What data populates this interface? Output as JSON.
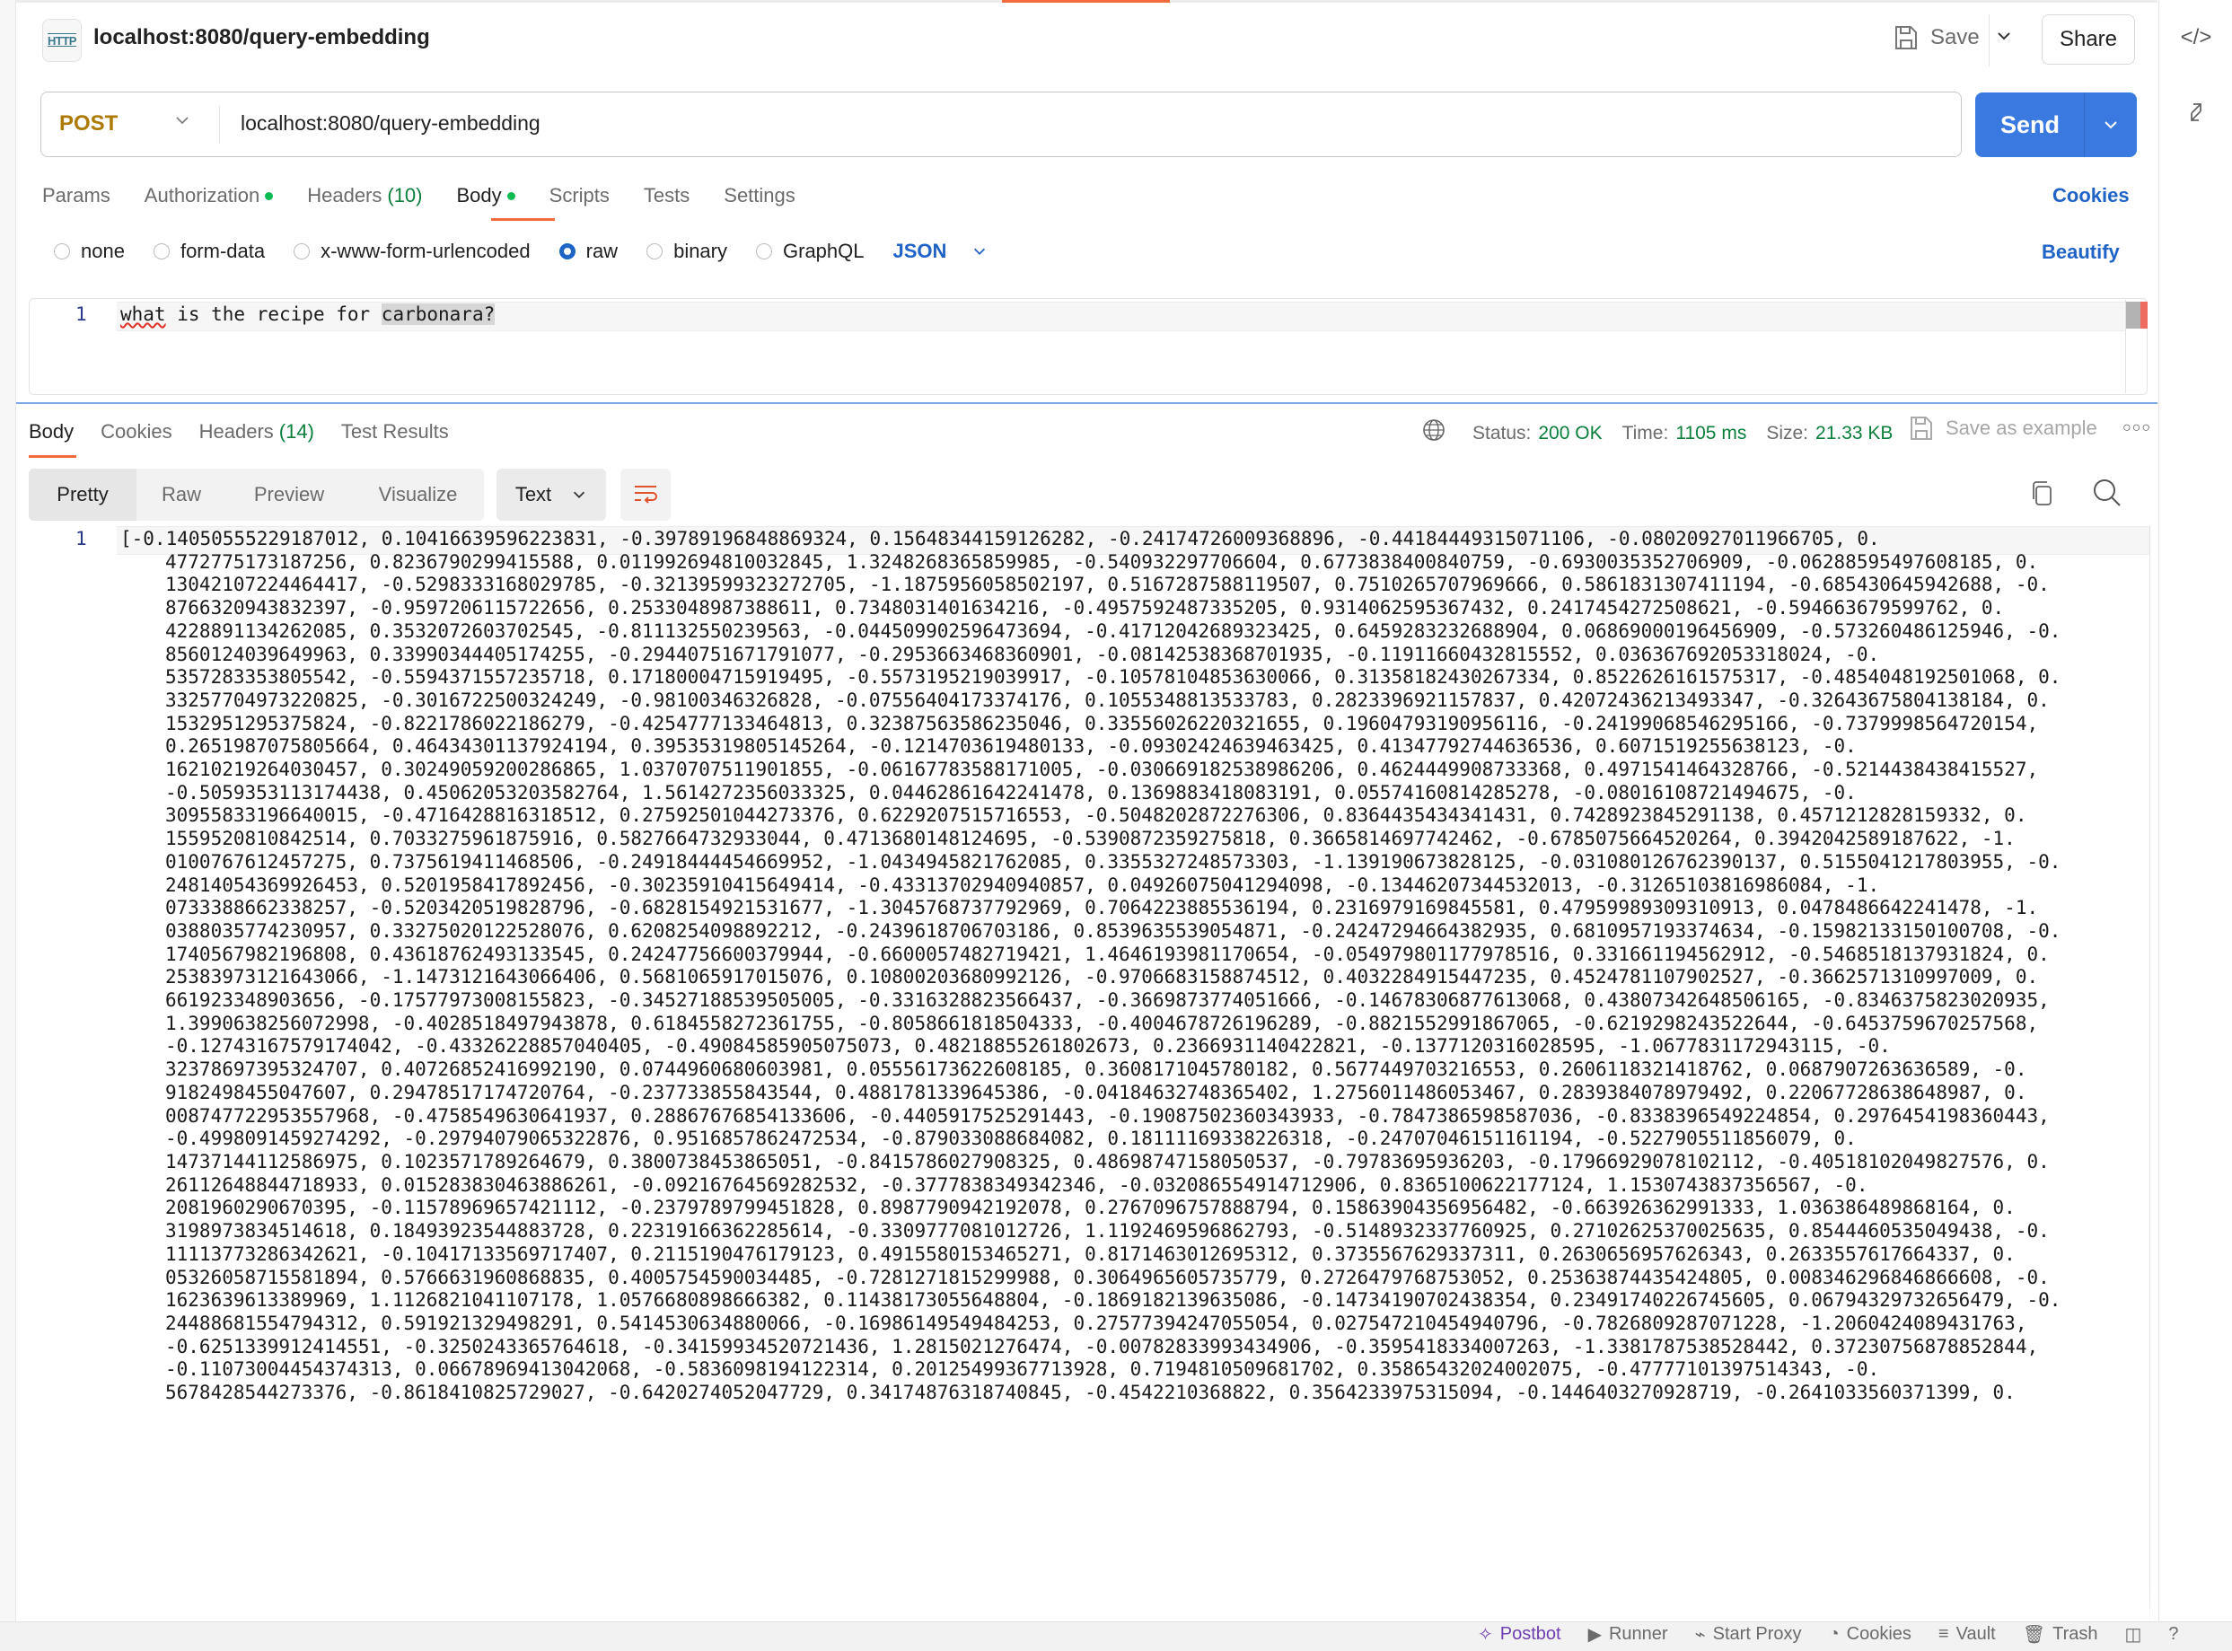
{
  "request": {
    "title": "localhost:8080/query-embedding",
    "icon": "http-icon",
    "icon_label": "HTTP",
    "save_label": "Save",
    "share_label": "Share",
    "method": "POST",
    "url": "localhost:8080/query-embedding",
    "send_label": "Send",
    "tabs": [
      {
        "label": "Params",
        "dot": false,
        "count": null
      },
      {
        "label": "Authorization",
        "dot": true,
        "count": null
      },
      {
        "label": "Headers",
        "dot": false,
        "count": "(10)"
      },
      {
        "label": "Body",
        "dot": true,
        "count": null,
        "active": true
      },
      {
        "label": "Scripts",
        "dot": false,
        "count": null
      },
      {
        "label": "Tests",
        "dot": false,
        "count": null
      },
      {
        "label": "Settings",
        "dot": false,
        "count": null
      }
    ],
    "cookies_link": "Cookies",
    "body_types": [
      {
        "label": "none",
        "checked": false
      },
      {
        "label": "form-data",
        "checked": false
      },
      {
        "label": "x-www-form-urlencoded",
        "checked": false
      },
      {
        "label": "raw",
        "checked": true
      },
      {
        "label": "binary",
        "checked": false
      },
      {
        "label": "GraphQL",
        "checked": false
      }
    ],
    "raw_format": "JSON",
    "beautify_label": "Beautify",
    "editor": {
      "line_number": "1",
      "text_prefix": "what is the recipe for ",
      "text_squiggled": "what",
      "text_between": " is the recipe for ",
      "text_selected": "carbonara?"
    }
  },
  "response": {
    "tabs": [
      {
        "label": "Body",
        "active": true
      },
      {
        "label": "Cookies"
      },
      {
        "label": "Headers",
        "count": "(14)"
      },
      {
        "label": "Test Results"
      }
    ],
    "status_label": "Status:",
    "status_value": "200 OK",
    "time_label": "Time:",
    "time_value": "1105 ms",
    "size_label": "Size:",
    "size_value": "21.33 KB",
    "save_example_label": "Save as example",
    "view_modes": [
      "Pretty",
      "Raw",
      "Preview",
      "Visualize"
    ],
    "active_view": "Pretty",
    "format": "Text",
    "line_number": "1",
    "body_lines": [
      "[-0.14050555229187012, 0.10416639596223831, -0.39789196848869324, 0.15648344159126282, -0.24174726009368896, -0.44184449315071106, -0.08020927011966705, 0.",
      "4772775173187256, 0.8236790299415588, 0.011992694810032845, 1.3248268365859985, -0.540932297706604, 0.6773838400840759, -0.6930035352706909, -0.06288595497608185, 0.",
      "13042107224464417, -0.5298333168029785, -0.32139599323272705, -1.1875956058502197, 0.5167287588119507, 0.7510265707969666, 0.5861831307411194, -0.685430645942688, -0.",
      "8766320943832397, -0.9597206115722656, 0.2533048987388611, 0.7348031401634216, -0.4957592487335205, 0.9314062595367432, 0.2417454272508621, -0.594663679599762, 0.",
      "4228891134262085, 0.3532072603702545, -0.811132550239563, -0.044509902596473694, -0.41712042689323425, 0.6459283232688904, 0.06869000196456909, -0.573260486125946, -0.",
      "8560124039649963, 0.33990344405174255, -0.29440751671791077, -0.2953663468360901, -0.08142538368701935, -0.11911660432815552, 0.036367692053318024, -0.",
      "5357283353805542, -0.5594371557235718, 0.17180004715919495, -0.5573195219039917, -0.10578104853630066, 0.31358182430267334, 0.8522626161575317, -0.4854048192501068, 0.",
      "33257704973220825, -0.3016722500324249, -0.98100346326828, -0.07556404173374176, 0.1055348813533783, 0.2823396921157837, 0.42072436213493347, -0.32643675804138184, 0.",
      "1532951295375824, -0.8221786022186279, -0.4254777133464813, 0.32387563586235046, 0.33556026220321655, 0.19604793190956116, -0.24199068546295166, -0.7379998564720154,",
      "0.2651987075805664, 0.46434301137924194, 0.39535319805145264, -0.1214703619480133, -0.09302424639463425, 0.41347792744636536, 0.6071519255638123, -0.",
      "16210219264030457, 0.30249059200286865, 1.0370707511901855, -0.06167783588171005, -0.030669182538986206, 0.4624449908733368, 0.4971541464328766, -0.5214438438415527,",
      "-0.5059353113174438, 0.45062053203582764, 1.5614272356033325, 0.04462861642241478, 0.1369883418083191, 0.05574160814285278, -0.08016108721494675, -0.",
      "30955833196640015, -0.4716428816318512, 0.27592501044273376, 0.6229207515716553, -0.5048202872276306, 0.8364435434341431, 0.7428923845291138, 0.4571212828159332, 0.",
      "1559520810842514, 0.7033275961875916, 0.5827664732933044, 0.4713680148124695, -0.5390872359275818, 0.3665814697742462, -0.6785075664520264, 0.3942042589187622, -1.",
      "0100767612457275, 0.7375619411468506, -0.24918444454669952, -1.0434945821762085, 0.3355327248573303, -1.139190673828125, -0.031080126762390137, 0.5155041217803955, -0.",
      "24814054369926453, 0.5201958417892456, -0.30235910415649414, -0.43313702940940857, 0.04926075041294098, -0.13446207344532013, -0.31265103816986084, -1.",
      "0733388662338257, -0.5203420519828796, -0.6828154921531677, -1.3045768737792969, 0.7064223885536194, 0.2316979169845581, 0.47959989309310913, 0.0478486642241478, -1.",
      "0388035774230957, 0.33275020122528076, 0.6208254098892212, -0.2439618706703186, 0.8539635539054871, -0.24247294664382935, 0.6810957193374634, -0.15982133150100708, -0.",
      "1740567982196808, 0.43618762493133545, 0.24247756600379944, -0.6600057482719421, 1.4646193981170654, -0.054979801177978516, 0.331661194562912, -0.5468518137931824, 0.",
      "25383973121643066, -1.1473121643066406, 0.5681065917015076, 0.10800203680992126, -0.9706683158874512, 0.4032284915447235, 0.4524781107902527, -0.3662571310997009, 0.",
      "661923348903656, -0.17577973008155823, -0.34527188539505005, -0.3316328823566437, -0.3669873774051666, -0.14678306877613068, 0.43807342648506165, -0.8346375823020935,",
      "1.3990638256072998, -0.4028518497943878, 0.6184558272361755, -0.8058661818504333, -0.4004678726196289, -0.8821552991867065, -0.6219298243522644, -0.6453759670257568,",
      "-0.12743167579174042, -0.43326228857040405, -0.49084585905075073, 0.48218855261802673, 0.2366931140422821, -0.1377120316028595, -1.0677831172943115, -0.",
      "32378697395324707, 0.40726852416992190, 0.0744960680603981, 0.05556173622608185, 0.3608171045780182, 0.5677449703216553, 0.2606118321418762, 0.0687907263636589, -0.",
      "9182498455047607, 0.29478517174720764, -0.237733855843544, 0.4881781339645386, -0.04184632748365402, 1.2756011486053467, 0.2839384078979492, 0.22067728638648987, 0.",
      "008747722953557968, -0.4758549630641937, 0.28867676854133606, -0.4405917525291443, -0.19087502360343933, -0.7847386598587036, -0.8338396549224854, 0.2976454198360443,",
      "-0.4998091459274292, -0.29794079065322876, 0.9516857862472534, -0.879033088684082, 0.18111169338226318, -0.24707046151161194, -0.5227905511856079, 0.",
      "14737144112586975, 0.1023571789264679, 0.3800738453865051, -0.8415786027908325, 0.48698747158050537, -0.79783695936203, -0.17966929078102112, -0.40518102049827576, 0.",
      "26112648844718933, 0.015283830463886261, -0.09216764569282532, -0.3777838349342346, -0.032086554914712906, 0.8365100622177124, 1.1530743837356567, -0.",
      "2081960290670395, -0.11578969657421112, -0.2379789799451828, 0.8987790942192078, 0.2767096757888794, 0.15863904356956482, -0.663926362991333, 1.036386489868164, 0.",
      "3198973834514618, 0.18493923544883728, 0.22319166362285614, -0.3309777081012726, 1.1192469596862793, -0.5148932337760925, 0.27102625370025635, 0.8544460535049438, -0.",
      "11113773286342621, -0.10417133569717407, 0.2115190476179123, 0.4915580153465271, 0.8171463012695312, 0.3735567629337311, 0.2630656957626343, 0.2633557617664337, 0.",
      "05326058715581894, 0.5766631960868835, 0.4005754590034485, -0.7281271815299988, 0.3064965605735779, 0.2726479768753052, 0.25363874435424805, 0.008346296846866608, -0.",
      "1623639613389969, 1.1126821041107178, 1.0576680898666382, 0.11438173055648804, -0.1869182139635086, -0.14734190702438354, 0.23491740226745605, 0.06794329732656479, -0.",
      "24488681554794312, 0.591921329498291, 0.5414530634880066, -0.16986149549484253, 0.27577394247055054, 0.027547210454940796, -0.7826809287071228, -1.2060424089431763,",
      "-0.6251339912414551, -0.3250243365764618, -0.34159934520721436, 1.2815021276474, -0.00782833993434906, -0.3595418334007263, -1.3381787538528442, 0.37230756878852844,",
      "-0.11073004454374313, 0.06678969413042068, -0.5836098194122314, 0.20125499367713928, 0.7194810509681702, 0.35865432024002075, -0.47777101397514343, -0.",
      "5678428544273376, -0.8618410825729027, -0.6420274052047729, 0.34174876318740845, -0.4542210368822, 0.3564233975315094, -0.1446403270928719, -0.2641033560371399, 0."
    ]
  },
  "status_bar": {
    "items": [
      {
        "label": "Postbot",
        "icon": "postbot-icon"
      },
      {
        "label": "Runner",
        "icon": "runner-icon"
      },
      {
        "label": "Start Proxy",
        "icon": "proxy-icon"
      },
      {
        "label": "Cookies",
        "icon": "cookie-icon"
      },
      {
        "label": "Vault",
        "icon": "vault-icon"
      },
      {
        "label": "Trash",
        "icon": "trash-icon"
      }
    ]
  },
  "colors": {
    "accent": "#3a7ae0",
    "active_tab": "#f26b3a",
    "method_post": "#ad7a03",
    "success": "#0a7f3c",
    "link": "#1f63c7",
    "postbot": "#6e3fb0"
  }
}
